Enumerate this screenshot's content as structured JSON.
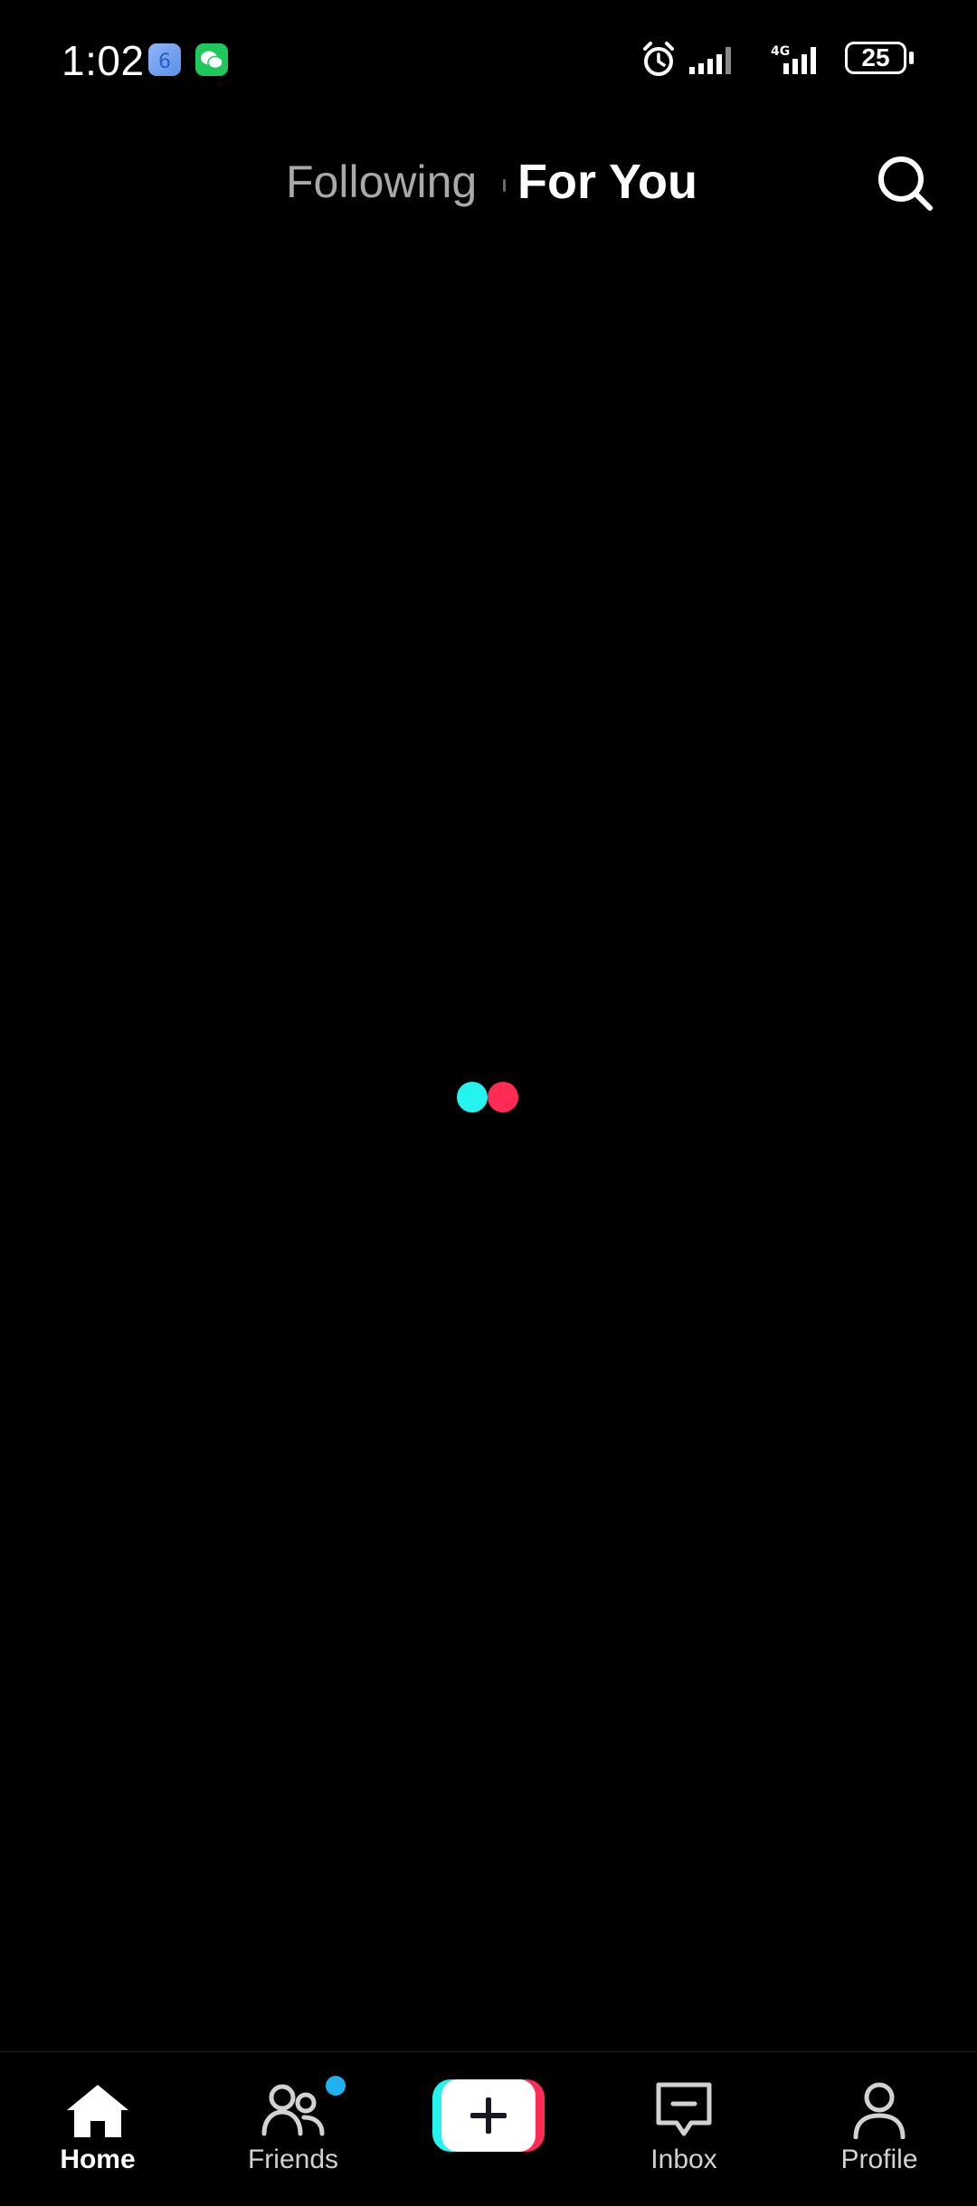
{
  "status_bar": {
    "time": "1:02",
    "notification_icons": [
      "app-6-icon",
      "wechat-icon"
    ],
    "battery_level": "25",
    "network_type": "4G"
  },
  "top_nav": {
    "tabs": [
      {
        "label": "Following",
        "active": false
      },
      {
        "label": "For You",
        "active": true
      }
    ],
    "search_icon": "search-icon"
  },
  "loader": {
    "colors": [
      "#25f4ee",
      "#fe2c55"
    ]
  },
  "bottom_nav": {
    "items": [
      {
        "label": "Home",
        "icon": "home-icon",
        "active": true
      },
      {
        "label": "Friends",
        "icon": "friends-icon",
        "active": false,
        "badge_color": "#20b2f0"
      },
      {
        "label": "",
        "icon": "plus-icon",
        "active": false
      },
      {
        "label": "Inbox",
        "icon": "inbox-icon",
        "active": false
      },
      {
        "label": "Profile",
        "icon": "profile-icon",
        "active": false
      }
    ]
  },
  "colors": {
    "background": "#000000",
    "inactive_tab": "#a9a9a9",
    "accent_cyan": "#25f4ee",
    "accent_red": "#fe2c55"
  }
}
